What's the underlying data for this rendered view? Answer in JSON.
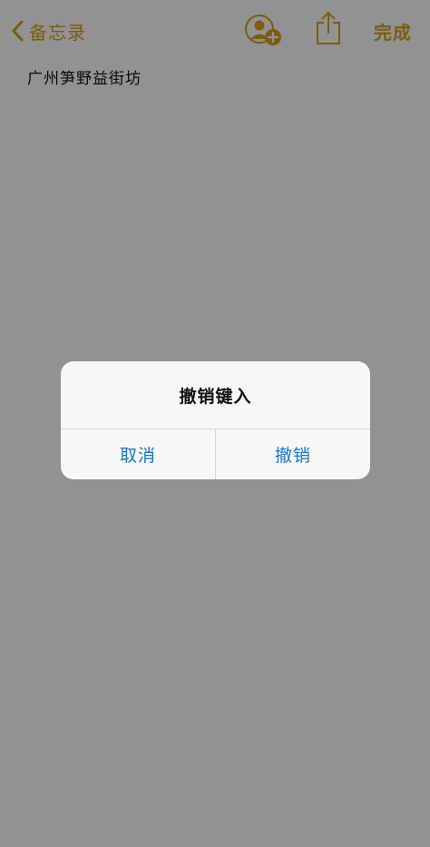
{
  "colors": {
    "accent": "#d4a01a",
    "button": "#1479c6",
    "overlay": "rgba(0,0,0,0.42)"
  },
  "navbar": {
    "back_label": "备忘录",
    "done_label": "完成",
    "icons": [
      "chevron-left-icon",
      "add-person-icon",
      "share-icon"
    ]
  },
  "note": {
    "text": "广州笋野益街坊"
  },
  "alert": {
    "title": "撤销键入",
    "cancel_label": "取消",
    "undo_label": "撤销"
  }
}
